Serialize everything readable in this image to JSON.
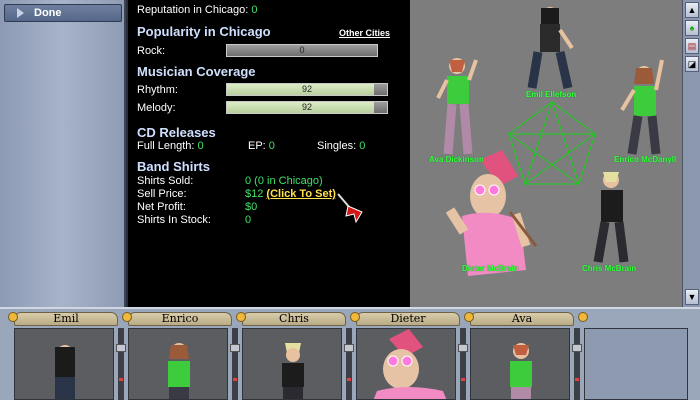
{
  "sidebar": {
    "done_label": "Done"
  },
  "stats": {
    "reputation_label": "Reputation in Chicago:",
    "reputation_value": "0",
    "popularity_header": "Popularity in Chicago",
    "other_cities_link": "Other Cities",
    "rock_label": "Rock:",
    "rock_value": "0",
    "rock_fraction": 0.0,
    "coverage_header": "Musician Coverage",
    "rhythm_label": "Rhythm:",
    "rhythm_value": "92",
    "rhythm_fraction": 0.92,
    "melody_label": "Melody:",
    "melody_value": "92",
    "melody_fraction": 0.92,
    "cd_header": "CD Releases",
    "full_length_label": "Full Length:",
    "full_length_value": "0",
    "ep_label": "EP:",
    "ep_value": "0",
    "singles_label": "Singles:",
    "singles_value": "0",
    "shirts_header": "Band Shirts",
    "shirts_sold_label": "Shirts Sold:",
    "shirts_sold_value": "0 (0 in Chicago)",
    "sell_price_label": "Sell Price:",
    "sell_price_value": "$12",
    "click_to_set": "(Click To Set)",
    "net_profit_label": "Net Profit:",
    "net_profit_value": "$0",
    "stock_label": "Shirts In Stock:",
    "stock_value": "0"
  },
  "scene": {
    "names": [
      "Emil Ellefson",
      "Ava Dickinson",
      "Enrico McDanyll",
      "Dieter McBrain",
      "Chris McBrain"
    ],
    "toolbar_icons": [
      "up-arrow-icon",
      "green-figure-icon",
      "chart-icon",
      "map-icon",
      "down-arrow-icon"
    ]
  },
  "roster": {
    "members": [
      "Emil",
      "Enrico",
      "Chris",
      "Dieter",
      "Ava"
    ]
  },
  "colors": {
    "highlight_green": "#3fe06a",
    "link_yellow": "#ffe24a",
    "header_blue": "#cfe0ff",
    "name_tag_green": "#37ff37"
  }
}
